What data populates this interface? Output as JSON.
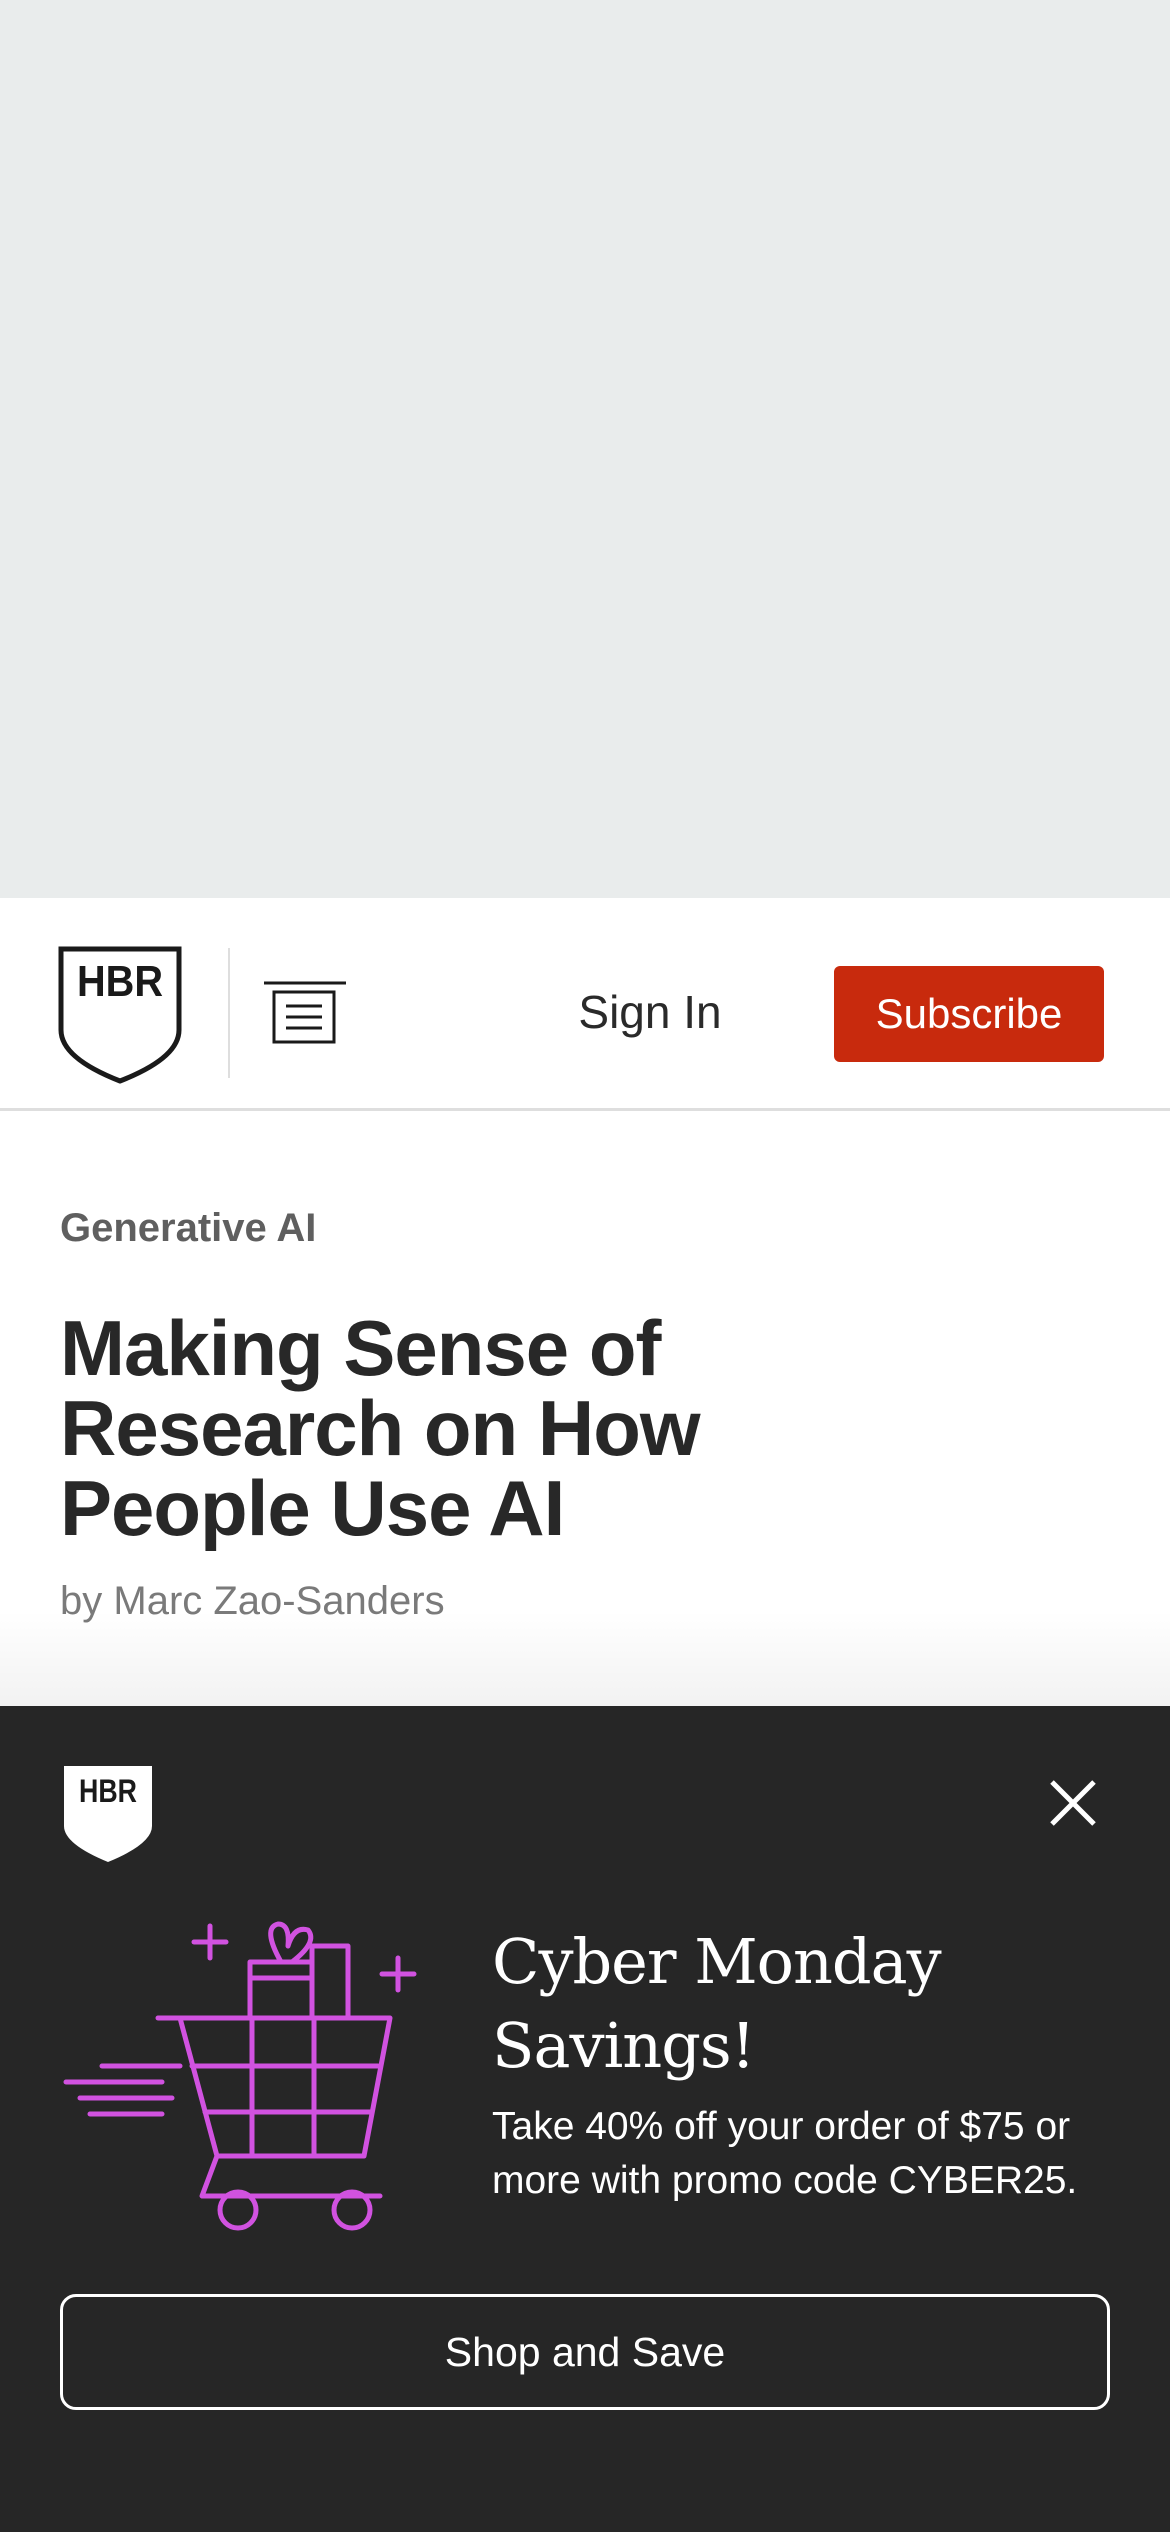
{
  "header": {
    "logo_text": "HBR",
    "logo_icon": "hbr-shield-logo",
    "menu_icon": "menu-icon",
    "sign_in_label": "Sign In",
    "subscribe_label": "Subscribe",
    "subscribe_color": "#c82a0d"
  },
  "article": {
    "topic": "Generative AI",
    "title": "Making Sense of Research on How People Use AI",
    "byline_prefix": "by",
    "author": "Marc Zao-Sanders"
  },
  "promo": {
    "logo_text": "HBR",
    "close_icon": "close-icon",
    "illustration_icon": "shopping-cart-gifts-icon",
    "accent_color": "#d152e0",
    "title": "Cyber Monday Savings!",
    "body": "Take 40% off your order of $75 or more with promo code CYBER25.",
    "button_label": "Shop and Save"
  }
}
